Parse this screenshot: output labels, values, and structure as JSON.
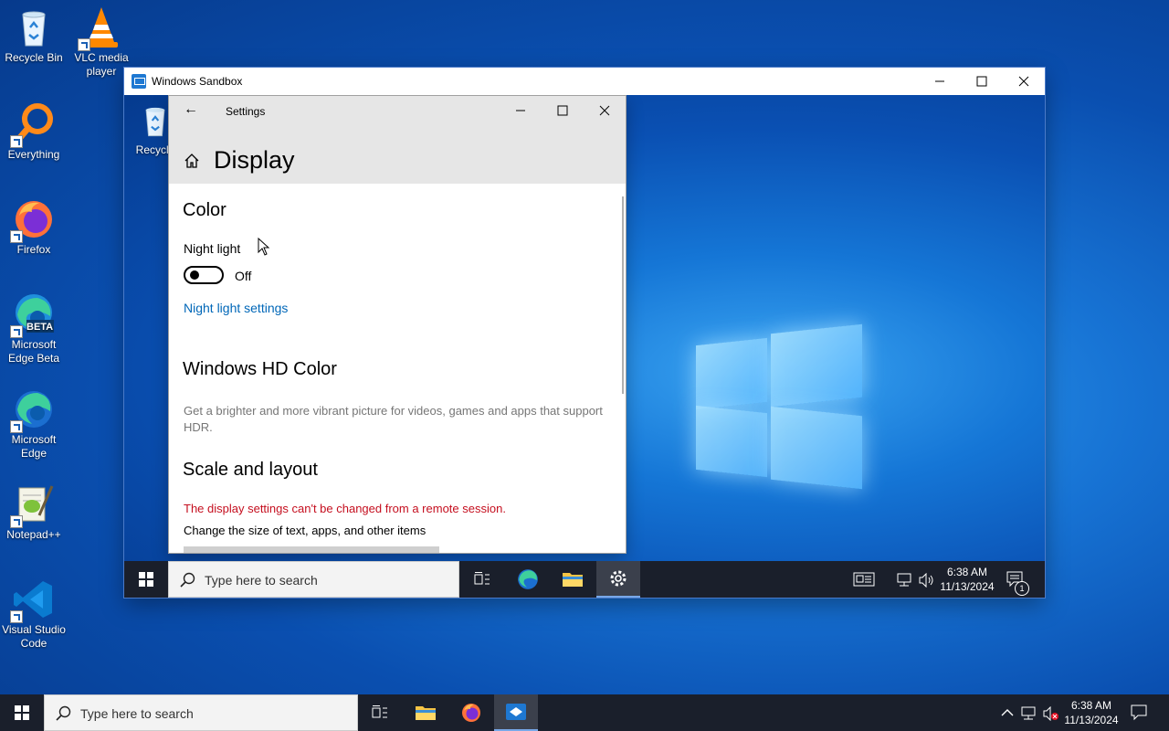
{
  "desktop": {
    "icons": [
      {
        "label": "Recycle Bin"
      },
      {
        "label": "VLC media player"
      },
      {
        "label": "Everything"
      },
      {
        "label": "Firefox"
      },
      {
        "label": "Microsoft Edge Beta"
      },
      {
        "label": "Microsoft Edge"
      },
      {
        "label": "Notepad++"
      },
      {
        "label": "Visual Studio Code"
      }
    ]
  },
  "sandbox": {
    "title": "Windows Sandbox",
    "desktop_icon_label": "Recycle",
    "settings": {
      "title": "Settings",
      "page_title": "Display",
      "section_color": "Color",
      "night_light_label": "Night light",
      "toggle_state": "Off",
      "night_light_link": "Night light settings",
      "section_hd": "Windows HD Color",
      "hd_description": "Get a brighter and more vibrant picture for videos, games and apps that support HDR.",
      "section_scale": "Scale and layout",
      "error_message": "The display settings can't be changed from a remote session.",
      "size_label": "Change the size of text, apps, and other items"
    },
    "taskbar": {
      "search_placeholder": "Type here to search",
      "time": "6:38 AM",
      "date": "11/13/2024",
      "notification_count": "1"
    }
  },
  "taskbar": {
    "search_placeholder": "Type here to search",
    "time": "6:38 AM",
    "date": "11/13/2024"
  },
  "colors": {
    "accent": "#0067b8",
    "error": "#c50f1f",
    "taskbar": "#1a1f2b"
  }
}
